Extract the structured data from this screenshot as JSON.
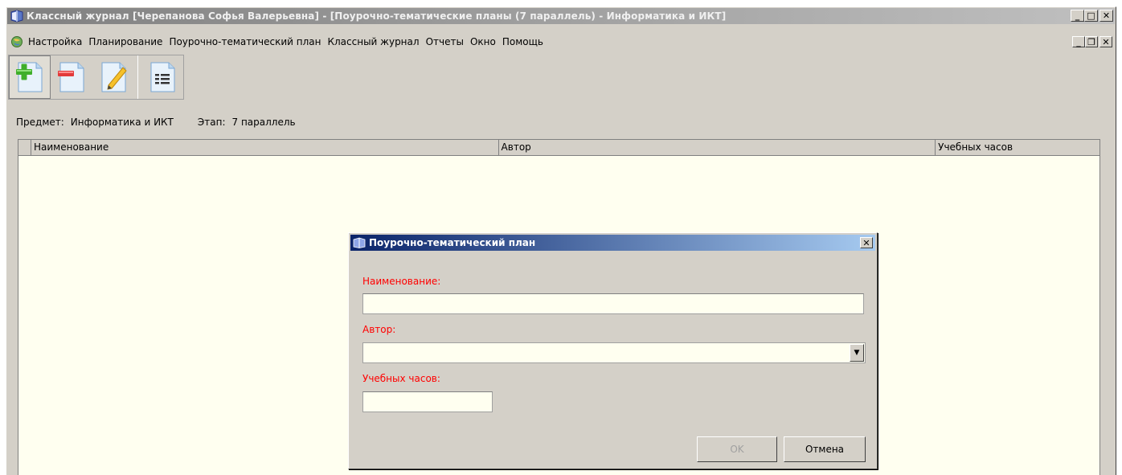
{
  "window": {
    "title": "Классный журнал [Черепанова  Софья  Валерьевна] - [Поурочно-тематические планы (7 параллель) - Информатика и ИКТ]",
    "icon": "book-icon",
    "buttons": {
      "minimize": "_",
      "maximize": "□",
      "close": "✕"
    }
  },
  "menubar": {
    "icon": "globe-icon",
    "items": [
      "Настройка",
      "Планирование",
      "Поурочно-тематический план",
      "Классный журнал",
      "Отчеты",
      "Окно",
      "Помощь"
    ],
    "mdi_buttons": {
      "minimize": "_",
      "restore": "❐",
      "close": "✕"
    }
  },
  "toolbar": {
    "buttons": [
      {
        "icon": "add-document-icon"
      },
      {
        "icon": "remove-document-icon"
      },
      {
        "icon": "edit-document-icon"
      },
      {
        "icon": "list-document-icon"
      }
    ]
  },
  "info": {
    "subject_label": "Предмет:",
    "subject_value": "Информатика и ИКТ",
    "stage_label": "Этап:",
    "stage_value": "7 параллель"
  },
  "grid": {
    "columns": [
      "Наименование",
      "Автор",
      "Учебных часов"
    ],
    "rows": []
  },
  "dialog": {
    "title": "Поурочно-тематический план",
    "close": "✕",
    "name_label": "Наименование:",
    "name_value": "",
    "author_label": "Автор:",
    "author_value": "",
    "hours_label": "Учебных часов:",
    "hours_value": "",
    "ok_label": "OK",
    "cancel_label": "Отмена",
    "combo_arrow": "▼"
  },
  "colors": {
    "required_label": "#ff0000",
    "dialog_title_start": "#0a246a",
    "dialog_title_end": "#a6caf0",
    "grid_background": "#fffff0"
  }
}
